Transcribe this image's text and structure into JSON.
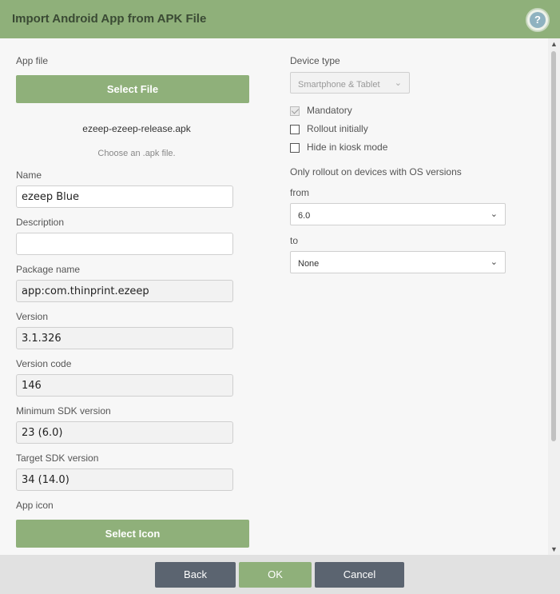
{
  "dialog": {
    "title": "Import Android App from APK File",
    "help_glyph": "?"
  },
  "left": {
    "app_file_label": "App file",
    "select_file_label": "Select File",
    "file_name": "ezeep-ezeep-release.apk",
    "file_hint": "Choose an .apk file.",
    "name_label": "Name",
    "name_value": "ezeep Blue",
    "description_label": "Description",
    "description_value": "",
    "package_label": "Package name",
    "package_value": "app:com.thinprint.ezeep",
    "version_label": "Version",
    "version_value": "3.1.326",
    "version_code_label": "Version code",
    "version_code_value": "146",
    "min_sdk_label": "Minimum SDK version",
    "min_sdk_value": "23 (6.0)",
    "target_sdk_label": "Target SDK version",
    "target_sdk_value": "34 (14.0)",
    "app_icon_label": "App icon",
    "select_icon_label": "Select Icon"
  },
  "right": {
    "device_type_label": "Device type",
    "device_type_value": "Smartphone & Tablet",
    "mandatory_label": "Mandatory",
    "mandatory_checked": true,
    "rollout_label": "Rollout initially",
    "rollout_checked": false,
    "kiosk_label": "Hide in kiosk mode",
    "kiosk_checked": false,
    "os_versions_label": "Only rollout on devices with OS versions",
    "from_label": "from",
    "from_value": "6.0",
    "to_label": "to",
    "to_value": "None"
  },
  "footer": {
    "back_label": "Back",
    "ok_label": "OK",
    "cancel_label": "Cancel"
  },
  "colors": {
    "accent_green": "#8fb07a",
    "footer_button_dark": "#5b6470"
  },
  "icons": {
    "help": "help-icon",
    "chevron": "chevron-down-icon",
    "checkmark": "checkmark-icon"
  }
}
